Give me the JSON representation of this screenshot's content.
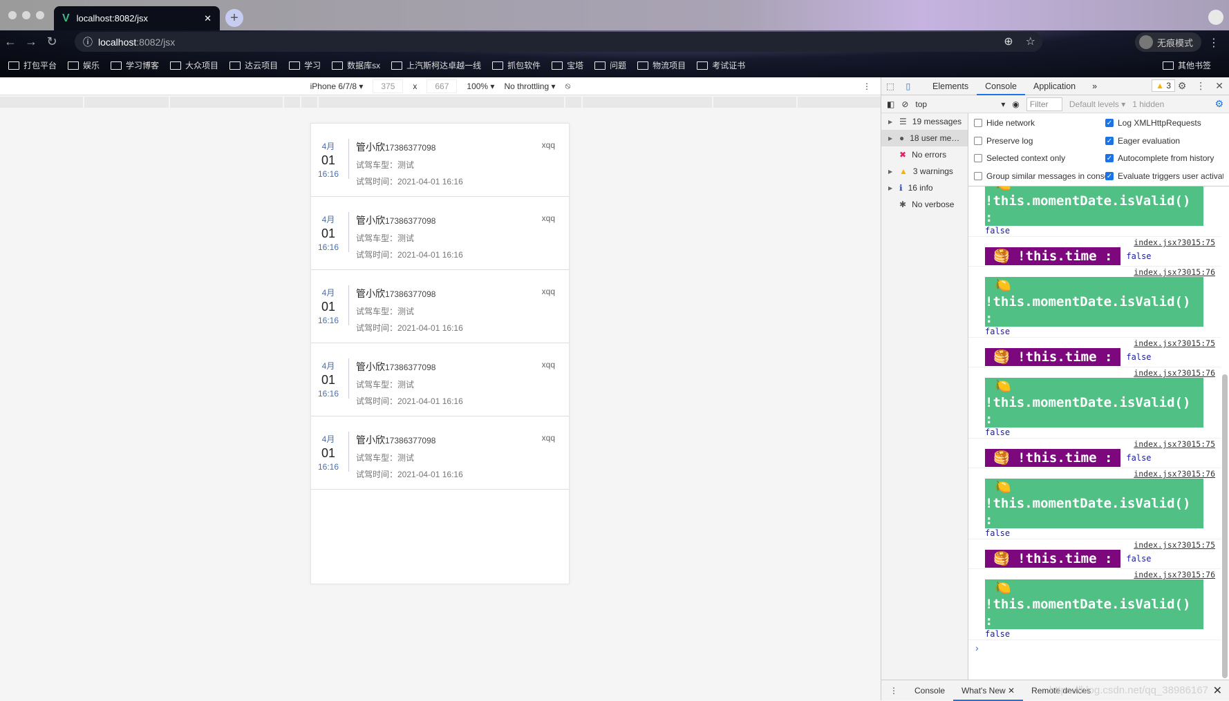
{
  "browser": {
    "tab_title": "localhost:8082/jsx",
    "url_host": "localhost",
    "url_rest": ":8082/jsx",
    "incognito_label": "无痕模式",
    "bookmarks": [
      "打包平台",
      "娱乐",
      "学习博客",
      "大众项目",
      "达云项目",
      "学习",
      "数据库sx",
      "上汽斯柯达卓越一线",
      "抓包软件",
      "宝塔",
      "问题",
      "物流项目",
      "考试证书"
    ],
    "other_bookmarks": "其他书签"
  },
  "device_toolbar": {
    "device": "iPhone 6/7/8 ▾",
    "width": "375",
    "height": "667",
    "x": "x",
    "zoom": "100% ▾",
    "throttling": "No throttling ▾"
  },
  "cards": [
    {
      "month": "4月",
      "day": "01",
      "time": "16:16",
      "name": "管小欣",
      "phone": "17386377098",
      "model": "试驾车型：测试",
      "drive_time": "试驾时间：2021-04-01 16:16",
      "tag": "xqq"
    },
    {
      "month": "4月",
      "day": "01",
      "time": "16:16",
      "name": "管小欣",
      "phone": "17386377098",
      "model": "试驾车型：测试",
      "drive_time": "试驾时间：2021-04-01 16:16",
      "tag": "xqq"
    },
    {
      "month": "4月",
      "day": "01",
      "time": "16:16",
      "name": "管小欣",
      "phone": "17386377098",
      "model": "试驾车型：测试",
      "drive_time": "试驾时间：2021-04-01 16:16",
      "tag": "xqq"
    },
    {
      "month": "4月",
      "day": "01",
      "time": "16:16",
      "name": "管小欣",
      "phone": "17386377098",
      "model": "试驾车型：测试",
      "drive_time": "试驾时间：2021-04-01 16:16",
      "tag": "xqq"
    },
    {
      "month": "4月",
      "day": "01",
      "time": "16:16",
      "name": "管小欣",
      "phone": "17386377098",
      "model": "试驾车型：测试",
      "drive_time": "试驾时间：2021-04-01 16:16",
      "tag": "xqq"
    }
  ],
  "devtools": {
    "tabs": [
      "Elements",
      "Console",
      "Application"
    ],
    "active_tab": "Console",
    "more": "»",
    "warning_count": "3",
    "context": "top",
    "filter_placeholder": "Filter",
    "levels": "Default levels ▾",
    "hidden": "1 hidden",
    "sidebar": [
      {
        "label": "19 messages",
        "icon": "list-icon",
        "glyph": "☰",
        "color": "#555"
      },
      {
        "label": "18 user me…",
        "icon": "user-icon",
        "glyph": "●",
        "color": "#555"
      },
      {
        "label": "No errors",
        "icon": "error-icon",
        "glyph": "✖",
        "color": "#e0245e"
      },
      {
        "label": "3 warnings",
        "icon": "warning-icon",
        "glyph": "▲",
        "color": "#f4b400"
      },
      {
        "label": "16 info",
        "icon": "info-icon",
        "glyph": "ℹ",
        "color": "#1a47c8"
      },
      {
        "label": "No verbose",
        "icon": "bug-icon",
        "glyph": "✱",
        "color": "#555"
      }
    ],
    "settings": [
      {
        "label": "Hide network",
        "checked": false
      },
      {
        "label": "Log XMLHttpRequests",
        "checked": true
      },
      {
        "label": "Preserve log",
        "checked": false
      },
      {
        "label": "Eager evaluation",
        "checked": true
      },
      {
        "label": "Selected context only",
        "checked": false
      },
      {
        "label": "Autocomplete from history",
        "checked": true
      },
      {
        "label": "Group similar messages in console",
        "checked": false
      },
      {
        "label": "Evaluate triggers user activation",
        "checked": true
      }
    ],
    "log": {
      "time_src": "index.jsx?3015:75",
      "moment_src": "index.jsx?3015:76",
      "time_text": "!this.time :",
      "moment_text": "!this.momentDate.isValid() :",
      "value": "false",
      "time_emoji": "🥞",
      "moment_emoji": "🍋"
    },
    "drawer": {
      "tabs": [
        "Console",
        "What's New",
        "Remote devices"
      ],
      "active": "What's New",
      "watermark": "https://blog.csdn.net/qq_38986167"
    }
  }
}
